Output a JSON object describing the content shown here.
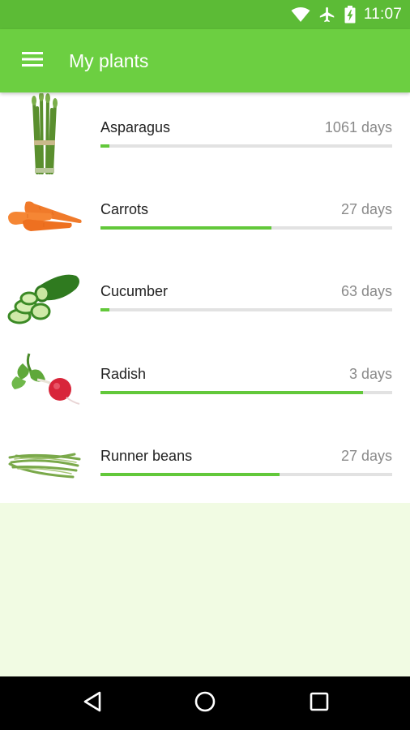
{
  "status_bar": {
    "time": "11:07",
    "icons": [
      "wifi-icon",
      "airplane-mode-icon",
      "battery-charging-icon"
    ]
  },
  "toolbar": {
    "menu_icon": "hamburger-menu-icon",
    "title": "My plants"
  },
  "plants": [
    {
      "name": "Asparagus",
      "days": "1061 days",
      "progress": 0.03,
      "image": "asparagus-image"
    },
    {
      "name": "Carrots",
      "days": "27 days",
      "progress": 0.585,
      "image": "carrots-image"
    },
    {
      "name": "Cucumber",
      "days": "63 days",
      "progress": 0.03,
      "image": "cucumber-image"
    },
    {
      "name": "Radish",
      "days": "3 days",
      "progress": 0.9,
      "image": "radish-image"
    },
    {
      "name": "Runner beans",
      "days": "27 days",
      "progress": 0.615,
      "image": "runner-beans-image"
    }
  ],
  "nav_bar": {
    "buttons": [
      "back-icon",
      "home-icon",
      "recents-icon"
    ]
  },
  "colors": {
    "status_bar": "#5cbb36",
    "toolbar": "#6ccf41",
    "progress_fill": "#62c83a",
    "progress_track": "#e2e2e2",
    "background": "#f1fbe3",
    "nav_bar": "#000000"
  }
}
